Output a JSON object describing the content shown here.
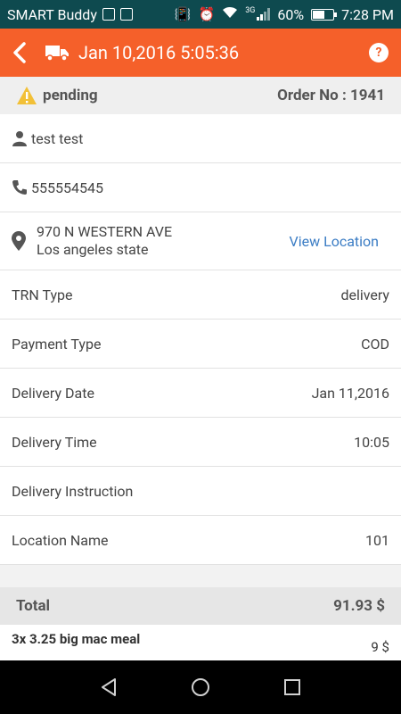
{
  "status_bar": {
    "carrier": "SMART Buddy",
    "network": "3G",
    "battery": "60%",
    "battery_level": 0.6,
    "time": "7:28 PM"
  },
  "toolbar": {
    "title": "Jan 10,2016 5:05:36",
    "help_label": "?"
  },
  "order": {
    "status": "pending",
    "order_no": "Order No : 1941"
  },
  "customer": {
    "name": "test test",
    "phone": "555554545",
    "address_line1": "970 N WESTERN AVE",
    "address_line2": "Los angeles state",
    "view_location_label": "View Location"
  },
  "details": [
    {
      "label": "TRN Type",
      "value": "delivery"
    },
    {
      "label": "Payment Type",
      "value": "COD"
    },
    {
      "label": "Delivery Date",
      "value": "Jan 11,2016"
    },
    {
      "label": "Delivery Time",
      "value": "10:05"
    },
    {
      "label": "Delivery Instruction",
      "value": ""
    },
    {
      "label": "Location Name",
      "value": "101"
    }
  ],
  "summary": {
    "total_label": "Total",
    "total_value": "91.93 $"
  },
  "items": [
    {
      "name": "3x 3.25 big mac meal",
      "price": "9 $"
    }
  ],
  "colors": {
    "accent": "#f5602a",
    "status_bar": "#0e4a4f",
    "link": "#3a7cc4",
    "warning": "#f2c037"
  }
}
